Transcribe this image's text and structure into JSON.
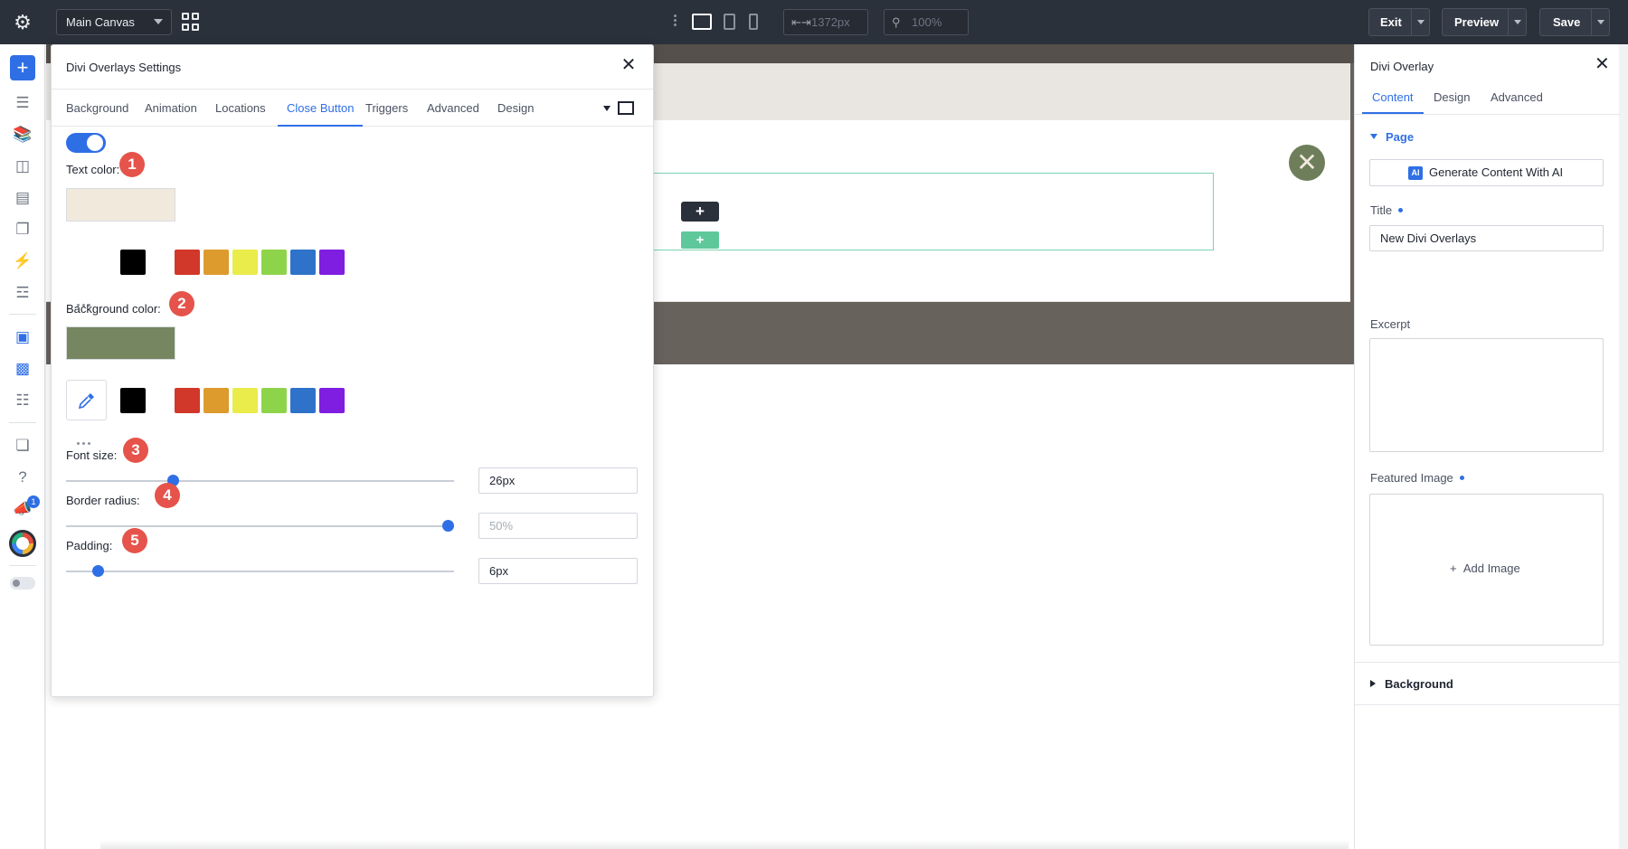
{
  "topbar": {
    "canvas_select": "Main Canvas",
    "width_value": "1372px",
    "zoom_value": "100%",
    "exit_label": "Exit",
    "preview_label": "Preview",
    "save_label": "Save"
  },
  "rail": {
    "notification_count": "1"
  },
  "modal": {
    "title": "Divi Overlays Settings",
    "tabs": [
      "Background",
      "Animation",
      "Locations",
      "Close Button",
      "Triggers",
      "Advanced",
      "Design"
    ],
    "active_tab": "Close Button",
    "toggle_on": true,
    "text_color": {
      "label": "Text color:",
      "badge": "1",
      "value_hex": "#f1e9dc"
    },
    "background_color": {
      "label": "Background color:",
      "badge": "2",
      "value_hex": "#768660"
    },
    "palette": [
      "#000000",
      "#d2382a",
      "#dd9b2e",
      "#e9ec4a",
      "#8ed44a",
      "#2e73c9",
      "#7f1ee0"
    ],
    "font_size": {
      "label": "Font size:",
      "badge": "3",
      "value": "26px",
      "slider_fraction": 0.27
    },
    "border_radius": {
      "label": "Border radius:",
      "badge": "4",
      "placeholder": "50%",
      "slider_fraction": 1.0
    },
    "padding": {
      "label": "Padding:",
      "badge": "5",
      "value": "6px",
      "slider_fraction": 0.07
    }
  },
  "right_panel": {
    "title": "Divi Overlay",
    "tabs": [
      "Content",
      "Design",
      "Advanced"
    ],
    "active_tab": "Content",
    "page_section": "Page",
    "ai_button": "Generate Content With AI",
    "ai_badge": "AI",
    "title_label": "Title",
    "title_value": "New Divi Overlays",
    "excerpt_label": "Excerpt",
    "featured_image_label": "Featured Image",
    "add_image": "Add Image",
    "background_section": "Background"
  },
  "colors": {
    "accent": "#2f6fe6",
    "topbar": "#2b313b",
    "number_badge": "#e5534b"
  }
}
